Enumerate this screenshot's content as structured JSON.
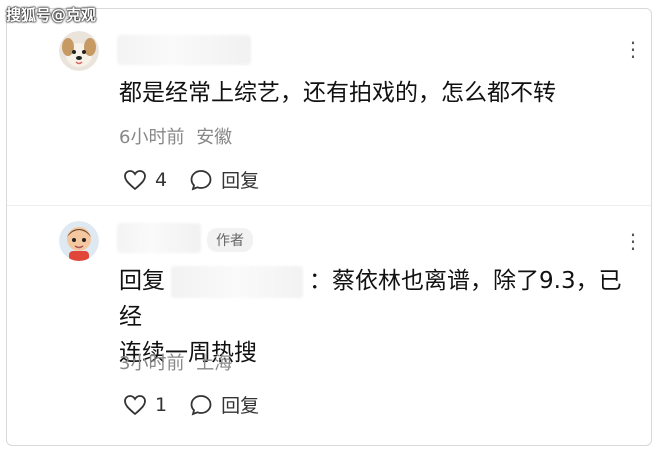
{
  "watermark": "搜狐号@克观",
  "comments": [
    {
      "text": "都是经常上综艺，还有拍戏的，怎么都不转",
      "time": "6小时前",
      "location": "安徽",
      "likes": "4",
      "reply_label": "回复",
      "more_icon": "more-dots-icon"
    },
    {
      "author_tag": "作者",
      "reply_prefix": "回复",
      "text_line1": "：蔡依林也离谱，除了9.3，已经",
      "text_line2": "连续一周热搜",
      "time": "3小时前",
      "location": "上海",
      "likes": "1",
      "reply_label": "回复",
      "more_icon": "more-dots-icon"
    }
  ]
}
